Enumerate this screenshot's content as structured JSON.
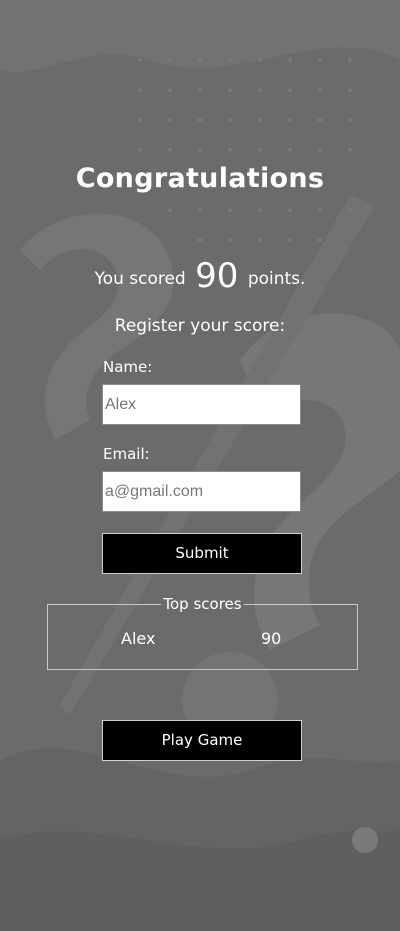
{
  "heading": "Congratulations",
  "score": {
    "prefix": "You scored",
    "value": "90",
    "suffix": "points."
  },
  "register_prompt": "Register your score:",
  "form": {
    "name_label": "Name:",
    "name_value": "Alex",
    "email_label": "Email:",
    "email_value": "a@gmail.com",
    "submit_label": "Submit"
  },
  "top_scores": {
    "title": "Top scores",
    "rows": [
      {
        "name": "Alex",
        "score": "90"
      }
    ]
  },
  "play_button_label": "Play Game",
  "colors": {
    "background": "#6b6b6b",
    "button": "#000000",
    "text": "#ffffff"
  }
}
